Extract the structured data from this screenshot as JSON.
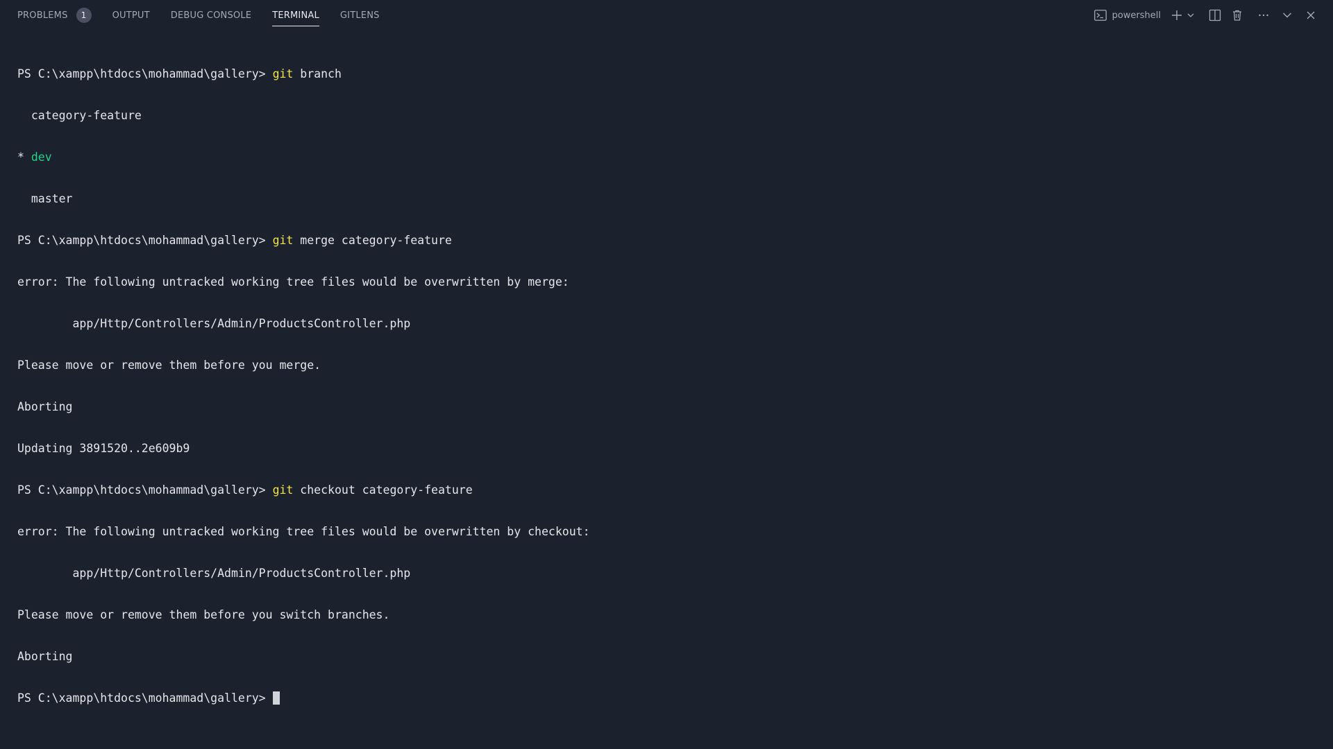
{
  "tabs": [
    {
      "label": "PROBLEMS",
      "badge": "1",
      "active": false
    },
    {
      "label": "OUTPUT",
      "active": false
    },
    {
      "label": "DEBUG CONSOLE",
      "active": false
    },
    {
      "label": "TERMINAL",
      "active": true
    },
    {
      "label": "GITLENS",
      "active": false
    }
  ],
  "toolbar": {
    "shell_label": "powershell",
    "icons": [
      "terminal-icon",
      "plus-icon",
      "chevron-down-icon",
      "split-icon",
      "trash-icon",
      "ellipsis-icon",
      "chevron-down-icon",
      "close-icon"
    ]
  },
  "terminal": {
    "prompt": "PS C:\\xampp\\htdocs\\mohammad\\gallery> ",
    "lines": [
      {
        "prompt": "PS C:\\xampp\\htdocs\\mohammad\\gallery> ",
        "cmd": "git",
        "args": " branch"
      },
      {
        "text": "  category-feature"
      },
      {
        "text": "* ",
        "green": "dev"
      },
      {
        "text": "  master"
      },
      {
        "prompt": "PS C:\\xampp\\htdocs\\mohammad\\gallery> ",
        "cmd": "git",
        "args": " merge category-feature"
      },
      {
        "text": "error: The following untracked working tree files would be overwritten by merge:"
      },
      {
        "text": "        app/Http/Controllers/Admin/ProductsController.php"
      },
      {
        "text": "Please move or remove them before you merge."
      },
      {
        "text": "Aborting"
      },
      {
        "text": "Updating 3891520..2e609b9"
      },
      {
        "prompt": "PS C:\\xampp\\htdocs\\mohammad\\gallery> ",
        "cmd": "git",
        "args": " checkout category-feature"
      },
      {
        "text": "error: The following untracked working tree files would be overwritten by checkout:"
      },
      {
        "text": "        app/Http/Controllers/Admin/ProductsController.php"
      },
      {
        "text": "Please move or remove them before you switch branches."
      },
      {
        "text": "Aborting"
      },
      {
        "prompt": "PS C:\\xampp\\htdocs\\mohammad\\gallery> ",
        "cursor": true
      }
    ]
  },
  "colors": {
    "background": "#1b212d",
    "command": "#f0e44a",
    "current_branch": "#23d18b",
    "text": "#e4e6ea"
  }
}
